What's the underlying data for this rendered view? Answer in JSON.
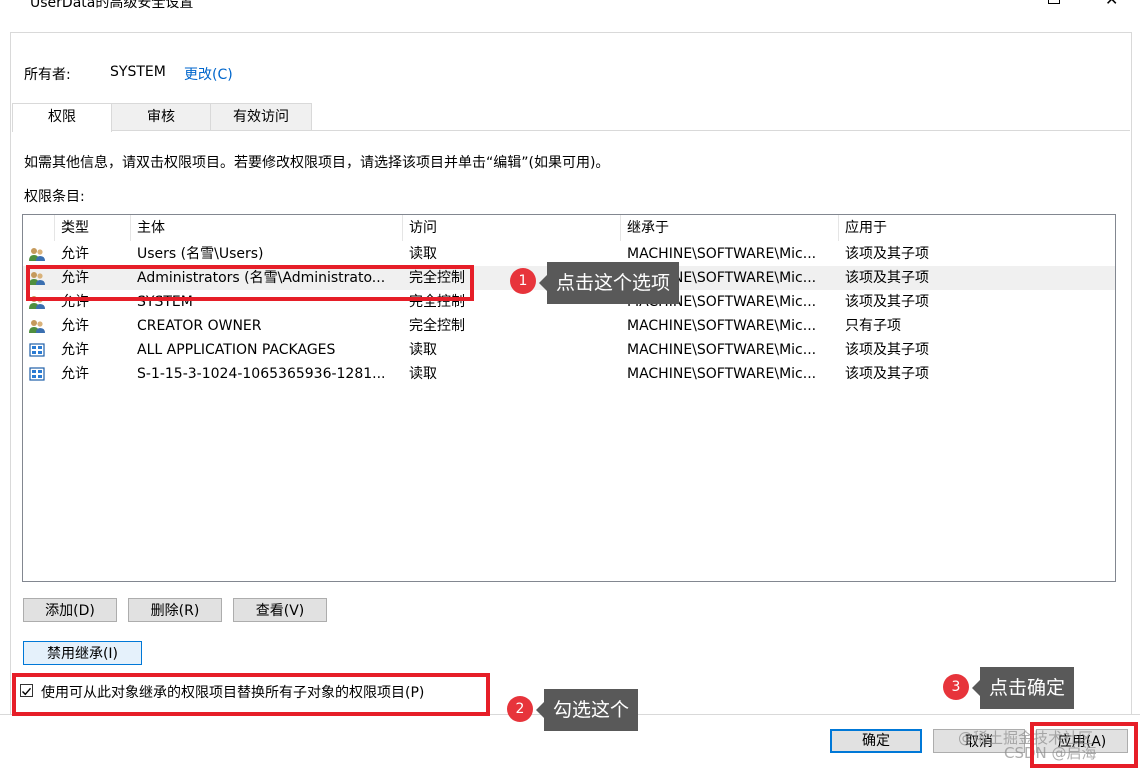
{
  "window": {
    "title": "UserData的高级安全设置"
  },
  "owner": {
    "label": "所有者:",
    "value": "SYSTEM",
    "change_link": "更改(C)"
  },
  "tabs": [
    {
      "label": "权限",
      "active": true
    },
    {
      "label": "审核",
      "active": false
    },
    {
      "label": "有效访问",
      "active": false
    }
  ],
  "description": "如需其他信息，请双击权限项目。若要修改权限项目，请选择该项目并单击“编辑”(如果可用)。",
  "entries_label": "权限条目:",
  "columns": [
    "类型",
    "主体",
    "访问",
    "继承于",
    "应用于"
  ],
  "rows": [
    {
      "icon": "users-icon",
      "type": "允许",
      "principal": "Users (名雪\\Users)",
      "access": "读取",
      "inherited": "MACHINE\\SOFTWARE\\Mic...",
      "applies": "该项及其子项"
    },
    {
      "icon": "users-icon",
      "type": "允许",
      "principal": "Administrators (名雪\\Administrato...",
      "access": "完全控制",
      "inherited": "MACHINE\\SOFTWARE\\Mic...",
      "applies": "该项及其子项"
    },
    {
      "icon": "users-icon",
      "type": "允许",
      "principal": "SYSTEM",
      "access": "完全控制",
      "inherited": "MACHINE\\SOFTWARE\\Mic...",
      "applies": "该项及其子项"
    },
    {
      "icon": "users-icon",
      "type": "允许",
      "principal": "CREATOR OWNER",
      "access": "完全控制",
      "inherited": "MACHINE\\SOFTWARE\\Mic...",
      "applies": "只有子项"
    },
    {
      "icon": "package-icon",
      "type": "允许",
      "principal": "ALL APPLICATION PACKAGES",
      "access": "读取",
      "inherited": "MACHINE\\SOFTWARE\\Mic...",
      "applies": "该项及其子项"
    },
    {
      "icon": "package-icon",
      "type": "允许",
      "principal": "S-1-15-3-1024-1065365936-1281...",
      "access": "读取",
      "inherited": "MACHINE\\SOFTWARE\\Mic...",
      "applies": "该项及其子项"
    }
  ],
  "buttons": {
    "add": "添加(D)",
    "remove": "删除(R)",
    "view": "查看(V)",
    "disable_inheritance": "禁用继承(I)",
    "ok": "确定",
    "cancel": "取消",
    "apply": "应用(A)"
  },
  "replace_checkbox": {
    "label": "使用可从此对象继承的权限项目替换所有子对象的权限项目(P)",
    "checked": true
  },
  "annotations": [
    {
      "number": "1",
      "text": "点击这个选项"
    },
    {
      "number": "2",
      "text": "勾选这个"
    },
    {
      "number": "3",
      "text": "点击确定"
    }
  ],
  "watermark": {
    "line1": "@稀土掘金技术社区",
    "line2": "CSDN @启海"
  },
  "colors": {
    "highlight_red": "#e61e28",
    "badge_red": "#e7343b",
    "callout_gray": "#595959",
    "link_blue": "#0066cc",
    "focus_blue": "#0078d7"
  }
}
